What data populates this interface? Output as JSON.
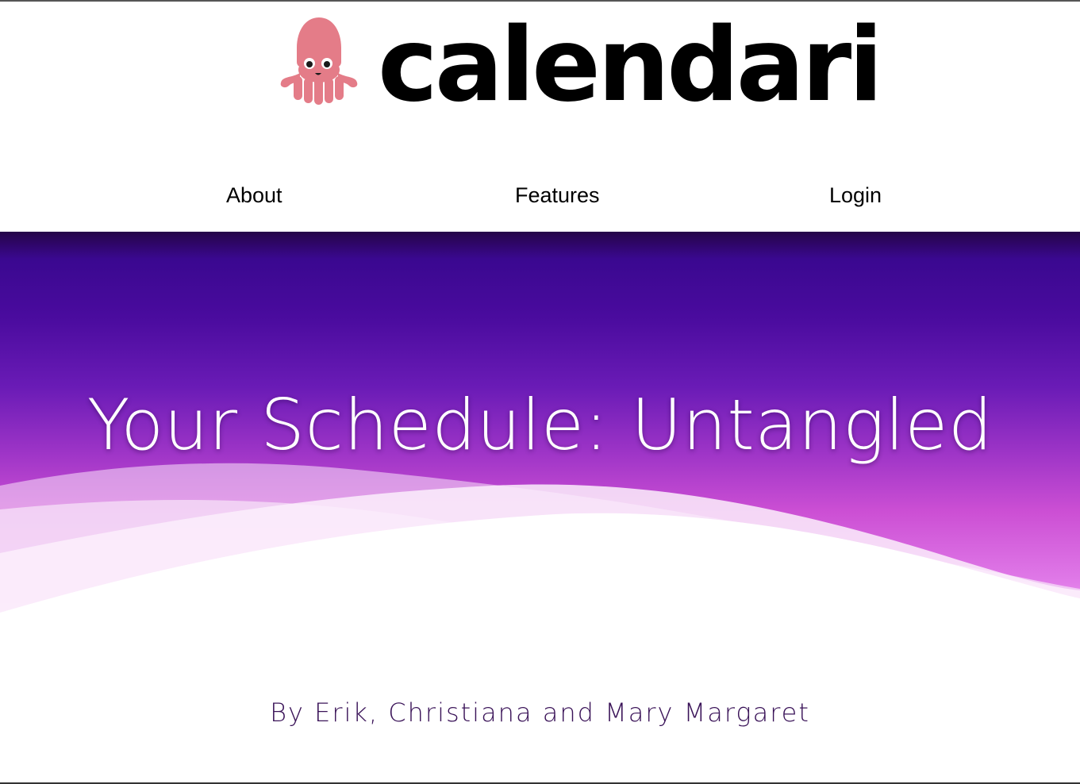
{
  "header": {
    "brand_name": "calendari",
    "mascot": "squid-icon",
    "nav": [
      {
        "label": "About"
      },
      {
        "label": "Features"
      },
      {
        "label": "Login"
      }
    ]
  },
  "hero": {
    "title": "Your Schedule: Untangled"
  },
  "credits": {
    "text": "By Erik, Christiana and Mary Margaret"
  },
  "colors": {
    "hero_top": "#250548",
    "hero_mid": "#4a0b9e",
    "hero_bottom": "#e07ae8",
    "mascot": "#e47c88",
    "credits_text": "#3a1358"
  }
}
